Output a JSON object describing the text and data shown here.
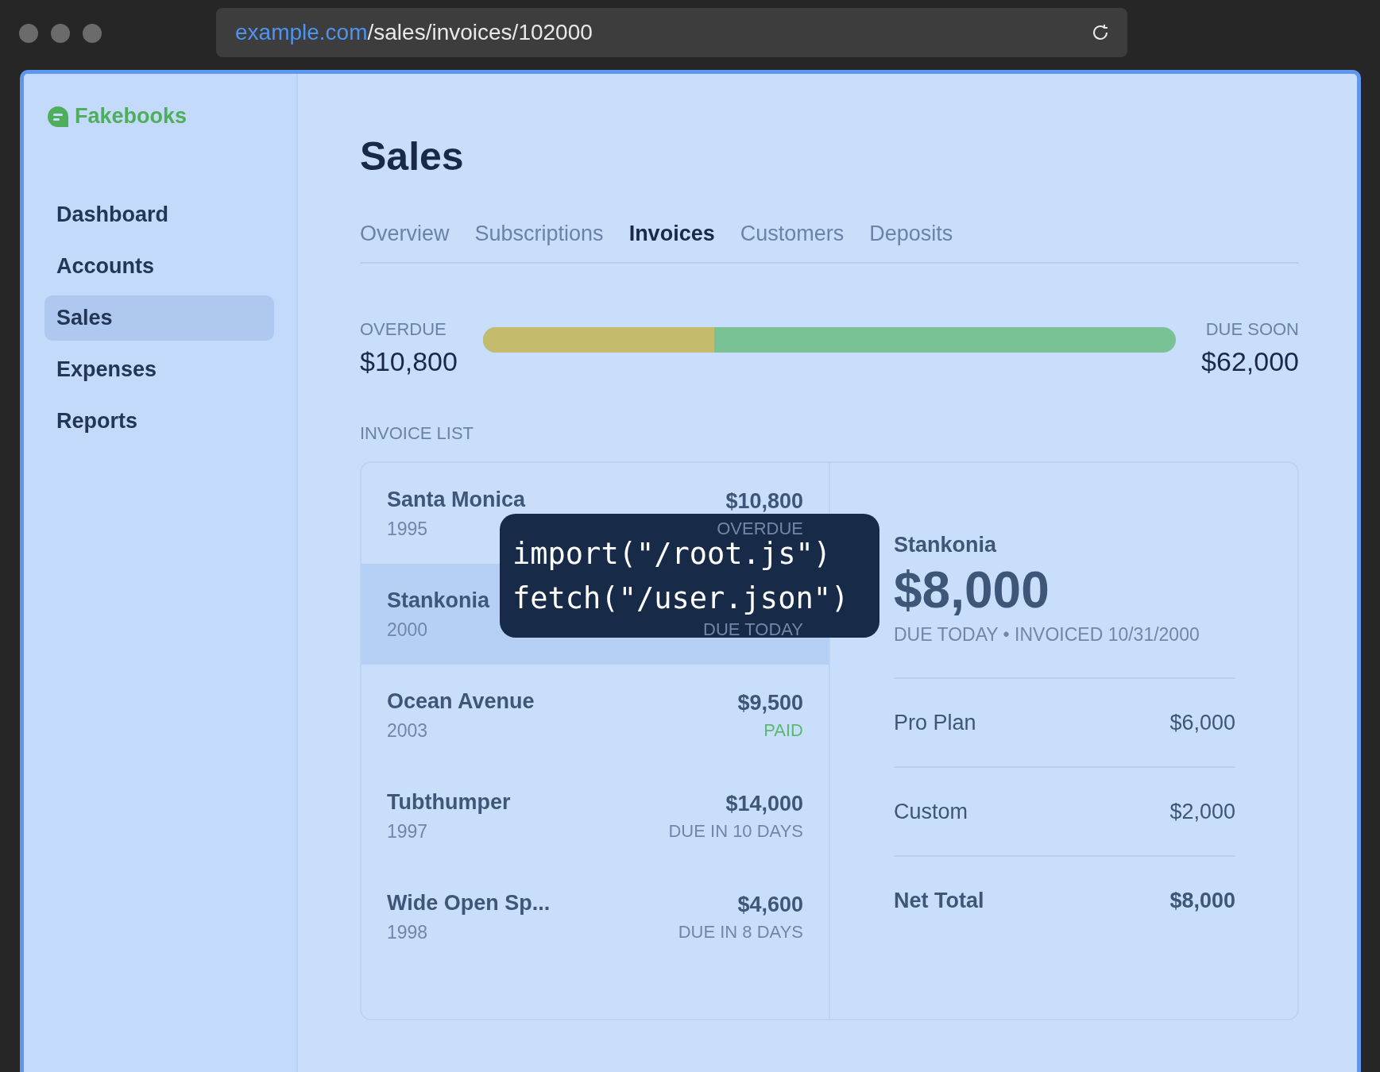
{
  "browser": {
    "url_host": "example.com",
    "url_path": "/sales/invoices/102000"
  },
  "sidebar": {
    "logo": "Fakebooks",
    "items": [
      {
        "label": "Dashboard",
        "selected": false
      },
      {
        "label": "Accounts",
        "selected": false
      },
      {
        "label": "Sales",
        "selected": true
      },
      {
        "label": "Expenses",
        "selected": false
      },
      {
        "label": "Reports",
        "selected": false
      }
    ]
  },
  "page": {
    "title": "Sales",
    "tabs": [
      {
        "label": "Overview",
        "selected": false
      },
      {
        "label": "Subscriptions",
        "selected": false
      },
      {
        "label": "Invoices",
        "selected": true
      },
      {
        "label": "Customers",
        "selected": false
      },
      {
        "label": "Deposits",
        "selected": false
      }
    ]
  },
  "summary": {
    "overdue_label": "OVERDUE",
    "overdue_amount": "$10,800",
    "due_soon_label": "DUE SOON",
    "due_soon_amount": "$62,000",
    "level": 0.334
  },
  "invoice_list": {
    "label": "INVOICE LIST",
    "rows": [
      {
        "name": "Santa Monica",
        "year": "1995",
        "amount": "$10,800",
        "status": "OVERDUE",
        "kind": "overdue",
        "selected": false
      },
      {
        "name": "Stankonia",
        "year": "2000",
        "status": "DUE TODAY",
        "kind": "due",
        "selected": true
      },
      {
        "name": "Ocean Avenue",
        "year": "2003",
        "amount": "$9,500",
        "status": "PAID",
        "kind": "paid",
        "selected": false
      },
      {
        "name": "Tubthumper",
        "year": "1997",
        "amount": "$14,000",
        "status": "DUE IN 10 DAYS",
        "kind": "due",
        "selected": false
      },
      {
        "name": "Wide Open Sp...",
        "year": "1998",
        "amount": "$4,600",
        "status": "DUE IN 8 DAYS",
        "kind": "due",
        "selected": false
      }
    ]
  },
  "detail": {
    "customer": "Stankonia",
    "amount": "$8,000",
    "subtitle": "DUE TODAY • INVOICED 10/31/2000",
    "lines": [
      {
        "label": "Pro Plan",
        "amount": "$6,000",
        "kind": "item"
      },
      {
        "label": "Custom",
        "amount": "$2,000",
        "kind": "item"
      },
      {
        "label": "Net Total",
        "amount": "$8,000",
        "kind": "total"
      }
    ]
  },
  "code_overlay": {
    "lines": [
      "import(\"/root.js\")",
      "fetch(\"/user.json\")"
    ]
  }
}
